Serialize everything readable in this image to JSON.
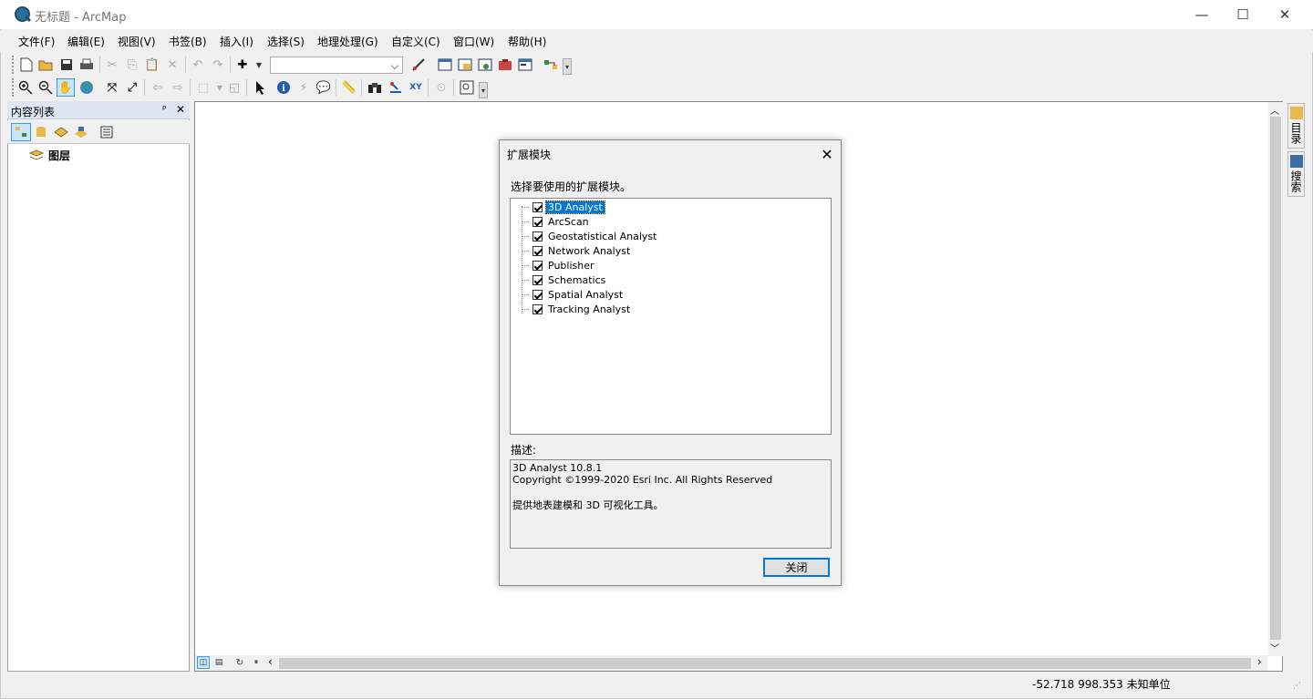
{
  "window": {
    "title": "无标题 - ArcMap",
    "controls": [
      "—",
      "☐",
      "✕"
    ]
  },
  "menus": [
    "文件(F)",
    "编辑(E)",
    "视图(V)",
    "书签(B)",
    "插入(I)",
    "选择(S)",
    "地理处理(G)",
    "自定义(C)",
    "窗口(W)",
    "帮助(H)"
  ],
  "toc": {
    "title": "内容列表",
    "pin": "ᵖ",
    "close": "✕",
    "layers_label": "图层"
  },
  "right_dock": {
    "catalog": "目录",
    "search": "搜索"
  },
  "dialog": {
    "title": "扩展模块",
    "prompt": "选择要使用的扩展模块。",
    "extensions": [
      {
        "label": "3D Analyst",
        "checked": true,
        "selected": true
      },
      {
        "label": "ArcScan",
        "checked": true,
        "selected": false
      },
      {
        "label": "Geostatistical Analyst",
        "checked": true,
        "selected": false
      },
      {
        "label": "Network Analyst",
        "checked": true,
        "selected": false
      },
      {
        "label": "Publisher",
        "checked": true,
        "selected": false
      },
      {
        "label": "Schematics",
        "checked": true,
        "selected": false
      },
      {
        "label": "Spatial Analyst",
        "checked": true,
        "selected": false
      },
      {
        "label": "Tracking Analyst",
        "checked": true,
        "selected": false
      }
    ],
    "description_label": "描述:",
    "description_line1": "3D Analyst 10.8.1",
    "description_line2": "Copyright ©1999-2020 Esri Inc. All Rights Reserved",
    "description_line3": "提供地表建模和 3D 可视化工具。",
    "close_button": "关闭"
  },
  "status": {
    "coordinates": "-52.718  998.353 未知单位"
  },
  "colors": {
    "selection": "#0078d7",
    "toc_header": "#dde6f2"
  }
}
